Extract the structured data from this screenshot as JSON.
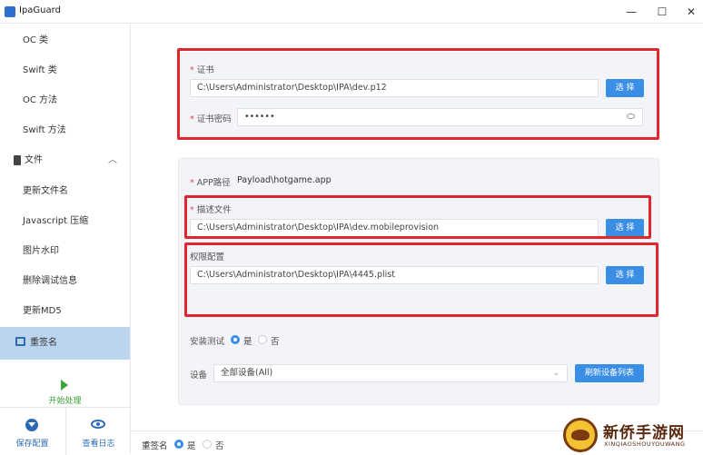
{
  "window": {
    "title": "IpaGuard",
    "minimize": "—",
    "maximize": "☐",
    "close": "✕"
  },
  "sidebar": {
    "items": [
      {
        "label": "OC 类"
      },
      {
        "label": "Swift 类"
      },
      {
        "label": "OC 方法"
      },
      {
        "label": "Swift 方法"
      }
    ],
    "group": {
      "label": "文件",
      "chevron": "︿"
    },
    "sub_items": [
      {
        "label": "更新文件名"
      },
      {
        "label": "Javascript 压缩"
      },
      {
        "label": "图片水印"
      },
      {
        "label": "删除调试信息"
      },
      {
        "label": "更新MD5"
      }
    ],
    "active_item": {
      "label": "重签名"
    },
    "start_label": "开始处理",
    "save_config_label": "保存配置",
    "view_log_label": "查看日志"
  },
  "cert_panel": {
    "cert_label": "证书",
    "cert_path": "C:\\Users\\Administrator\\Desktop\\IPA\\dev.p12",
    "choose_label": "选 择",
    "password_label": "证书密码",
    "password_value": "••••••"
  },
  "files_panel": {
    "app_path_label": "APP路径",
    "app_path_value": "Payload\\hotgame.app",
    "profile_label": "描述文件",
    "profile_path": "C:\\Users\\Administrator\\Desktop\\IPA\\dev.mobileprovision",
    "choose_label": "选 择",
    "entitlements_label": "权限配置",
    "entitlements_path": "C:\\Users\\Administrator\\Desktop\\IPA\\4445.plist",
    "choose_label_2": "选 择",
    "install_test_label": "安装测试",
    "yes_label": "是",
    "no_label": "否",
    "install_test_selected": "是",
    "device_label": "设备",
    "device_value": "全部设备(All)",
    "refresh_label": "刷新设备列表"
  },
  "footer": {
    "resign_label": "重签名",
    "yes_label": "是",
    "no_label": "否",
    "selected": "是"
  },
  "watermark": {
    "title": "新侨手游网",
    "subtitle": "XINQIAOSHOUYOUWANG"
  },
  "colors": {
    "accent": "#3a8ee6",
    "highlight": "#e0262f",
    "active_nav": "#bcd5ef"
  }
}
